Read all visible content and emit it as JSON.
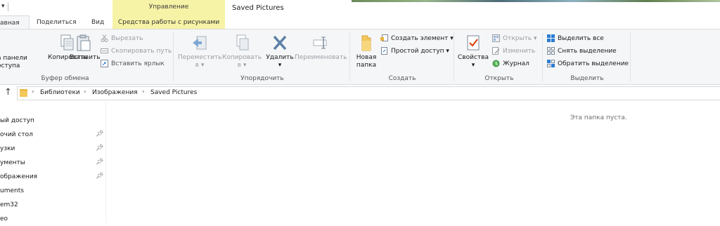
{
  "titlebar": {
    "manage_label": "Управление",
    "window_title": "Saved Pictures"
  },
  "tabs": {
    "home": "авная",
    "share": "Поделиться",
    "view": "Вид",
    "tools": "Средства работы с рисунками"
  },
  "ribbon": {
    "clipboard": {
      "pin_label_1": "а панели",
      "pin_label_2": "оступа",
      "copy": "Копировать",
      "paste": "Вставить",
      "cut": "Вырезать",
      "copy_path": "Скопировать путь",
      "paste_shortcut": "Вставить ярлык",
      "group": "Буфер обмена"
    },
    "organize": {
      "move_1": "Переместить",
      "move_2": "в",
      "copy_to_1": "Копировать",
      "copy_to_2": "в",
      "delete": "Удалить",
      "rename": "Переименовать",
      "group": "Упорядочить"
    },
    "new": {
      "new_folder_1": "Новая",
      "new_folder_2": "папка",
      "new_item": "Создать элемент",
      "easy_access": "Простой доступ",
      "group": "Создать"
    },
    "open": {
      "properties": "Свойства",
      "open": "Открыть",
      "edit": "Изменить",
      "history": "Журнал",
      "group": "Открыть"
    },
    "select": {
      "select_all": "Выделить все",
      "select_none": "Снять выделение",
      "invert": "Обратить выделение",
      "group": "Выделить"
    }
  },
  "address": {
    "crumbs": [
      "Библиотеки",
      "Изображения",
      "Saved Pictures"
    ]
  },
  "nav": {
    "items": [
      "ый доступ",
      "очий стол",
      "узки",
      "ументы",
      "ображения",
      "uments",
      "em32",
      "ео"
    ]
  },
  "content": {
    "empty_message": "Эта папка пуста."
  },
  "colors": {
    "contextual_tab": "#f7f3a6",
    "ribbon_bg": "#f5f6f7",
    "folder": "#f2c75c",
    "accent_blue": "#2b7cd3",
    "delete_blue": "#5b7fa8"
  }
}
